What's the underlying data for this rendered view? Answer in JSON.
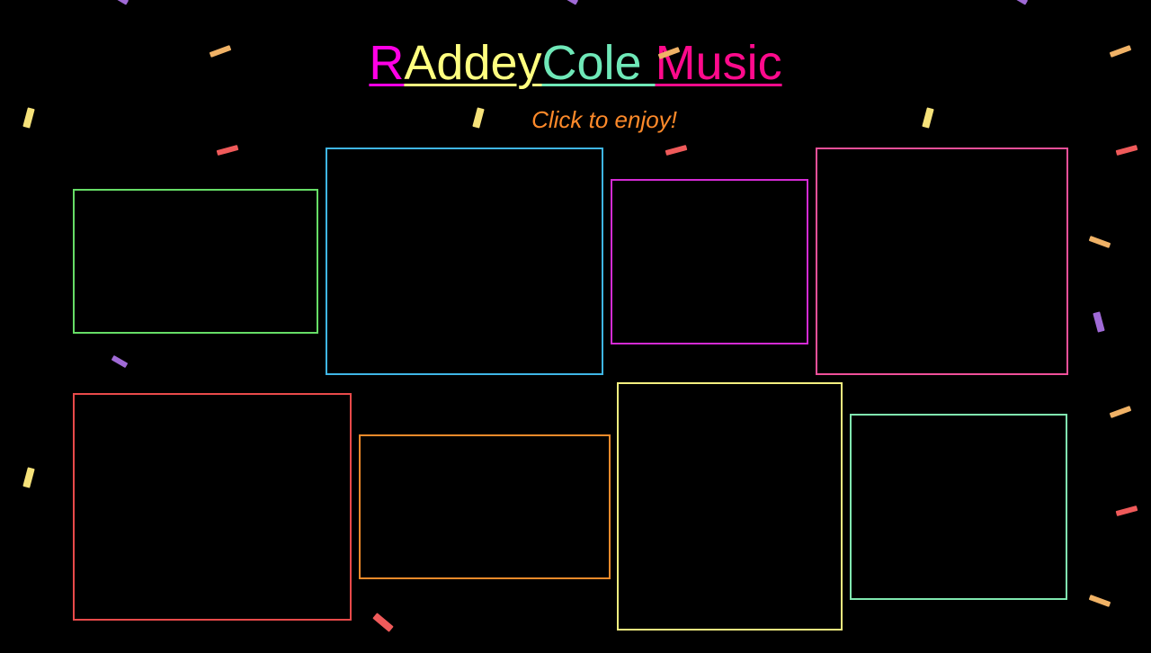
{
  "title": {
    "parts": [
      {
        "text": "R",
        "color": "#ff00e6"
      },
      {
        "text": "Addey",
        "color": "#ffff80"
      },
      {
        "text": "Cole ",
        "color": "#6fe8b8"
      },
      {
        "text": "Music",
        "color": "#ff0a8c"
      }
    ]
  },
  "subtitle": {
    "text": "Click to enjoy!",
    "color": "#ff8a2a"
  },
  "cards": [
    {
      "id": "card-1",
      "color": "#66dd66"
    },
    {
      "id": "card-2",
      "color": "#3fb6e6"
    },
    {
      "id": "card-3",
      "color": "#d42bd4"
    },
    {
      "id": "card-4",
      "color": "#f0509a"
    },
    {
      "id": "card-5",
      "color": "#e84a4a"
    },
    {
      "id": "card-6",
      "color": "#f08a2a"
    },
    {
      "id": "card-7",
      "color": "#f4ef80"
    },
    {
      "id": "card-8",
      "color": "#80e8b0"
    }
  ],
  "confetti_colors": [
    "#f6e27a",
    "#f0b266",
    "#ef5a5a",
    "#a06ad6"
  ]
}
